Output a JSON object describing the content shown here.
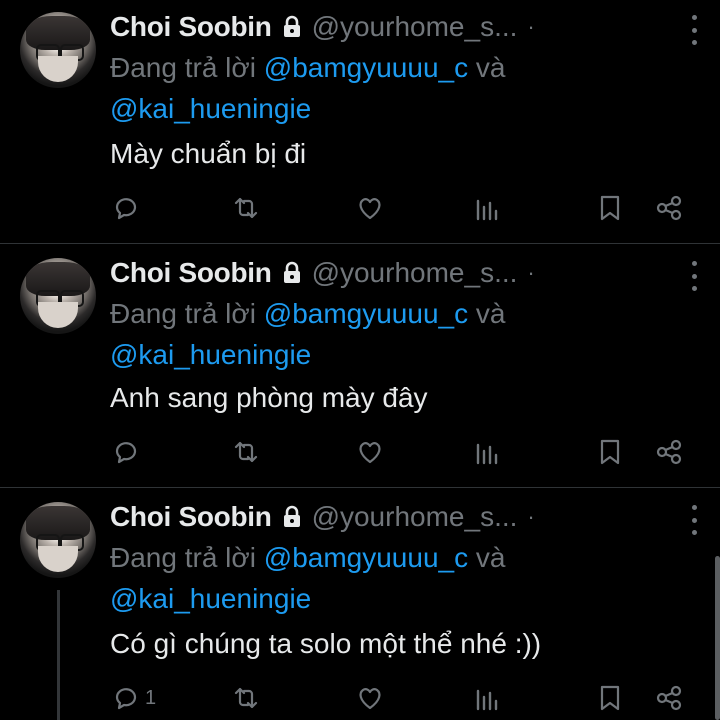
{
  "tweets": [
    {
      "name": "Choi Soobin",
      "handle": "@yourhome_s...",
      "separator": "·",
      "reply_prefix": "Đang trả lời",
      "mention1": "@bamgyuuuu_c",
      "conj": "và",
      "mention2": "@kai_hueningie",
      "text": "Mày chuẩn bị đi",
      "reply_count": ""
    },
    {
      "name": "Choi Soobin",
      "handle": "@yourhome_s...",
      "separator": "·",
      "reply_prefix": "Đang trả lời",
      "mention1": "@bamgyuuuu_c",
      "conj": "và",
      "mention2": "@kai_hueningie",
      "text": "Anh sang phòng mày đây",
      "reply_count": ""
    },
    {
      "name": "Choi Soobin",
      "handle": "@yourhome_s...",
      "separator": "·",
      "reply_prefix": "Đang trả lời",
      "mention1": "@bamgyuuuu_c",
      "conj": "và",
      "mention2": "@kai_hueningie",
      "text": "Có gì chúng ta solo một thể nhé :))",
      "reply_count": "1"
    }
  ],
  "icons": {
    "reply": "reply-icon",
    "retweet": "retweet-icon",
    "like": "heart-icon",
    "views": "views-icon",
    "bookmark": "bookmark-icon",
    "share": "share-icon",
    "more": "more-icon",
    "lock": "lock-icon"
  },
  "colors": {
    "background": "#000000",
    "text": "#e7e9ea",
    "muted": "#71767b",
    "mention": "#1d9bf0",
    "divider": "#2f3336"
  }
}
